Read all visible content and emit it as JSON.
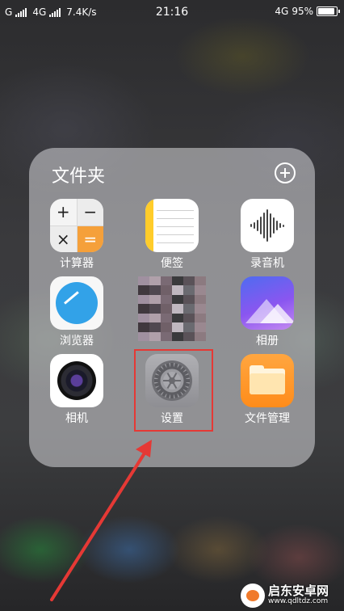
{
  "status_bar": {
    "carrier1": "G",
    "carrier2": "4G",
    "net_speed": "7.4K/s",
    "time": "21:16",
    "net_type": "4G",
    "battery_percent": "95%",
    "battery_level": 0.95
  },
  "folder": {
    "title": "文件夹",
    "apps": [
      {
        "label": "计算器",
        "icon": "calculator-icon"
      },
      {
        "label": "便签",
        "icon": "notes-icon"
      },
      {
        "label": "录音机",
        "icon": "voice-recorder-icon"
      },
      {
        "label": "浏览器",
        "icon": "browser-icon"
      },
      {
        "label": "",
        "icon": "pixelated-app-icon"
      },
      {
        "label": "相册",
        "icon": "gallery-icon"
      },
      {
        "label": "相机",
        "icon": "camera-icon"
      },
      {
        "label": "设置",
        "icon": "settings-gear-icon"
      },
      {
        "label": "文件管理",
        "icon": "file-manager-icon"
      }
    ]
  },
  "calculator_keys": [
    "+",
    "−",
    "×",
    "="
  ],
  "annotation": {
    "highlight_color": "#e53935"
  },
  "watermark": {
    "name": "启东安卓网",
    "url": "www.qdltdz.com"
  }
}
